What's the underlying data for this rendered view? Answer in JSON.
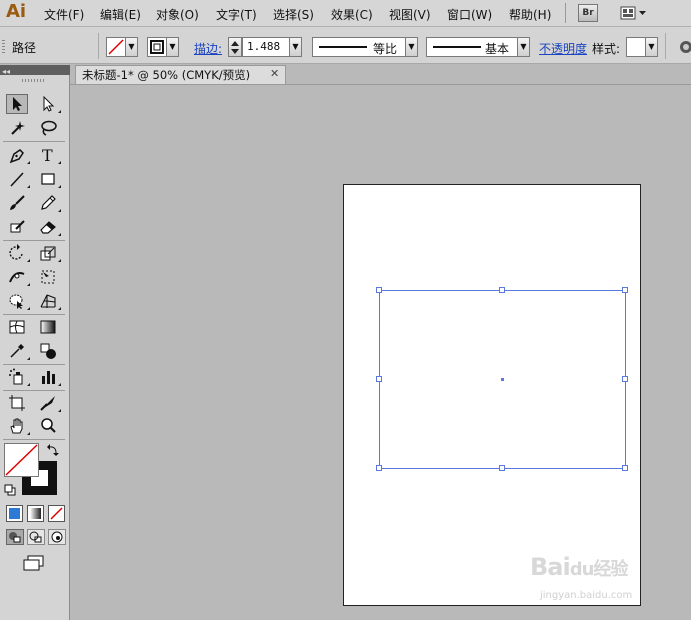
{
  "app": {
    "logo": "Ai"
  },
  "menu": [
    "文件(F)",
    "编辑(E)",
    "对象(O)",
    "文字(T)",
    "选择(S)",
    "效果(C)",
    "视图(V)",
    "窗口(W)",
    "帮助(H)"
  ],
  "menubar_buttons": {
    "bridge": "Br"
  },
  "control": {
    "selection_label": "路径",
    "stroke_label": "描边:",
    "stroke_value": "1.488",
    "profile_label": "等比",
    "brush_label": "基本",
    "opacity_label": "不透明度",
    "style_label": "样式:"
  },
  "document": {
    "tab_title": "未标题-1* @ 50% (CMYK/预览)",
    "close_glyph": "✕"
  },
  "watermark": {
    "main": "Bai",
    "paw": "du",
    "suffix": "经验",
    "url": "jingyan.baidu.com"
  },
  "colors": {
    "selection": "#5a78e0",
    "logo": "#9a5a10",
    "link": "#1a44c0"
  }
}
